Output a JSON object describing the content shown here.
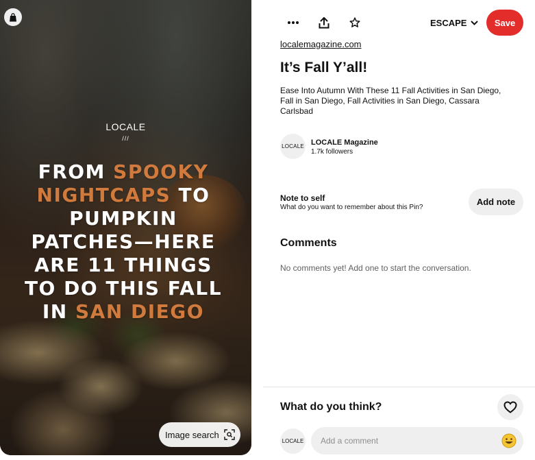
{
  "image_panel": {
    "brand": "LOCALE",
    "brand_mark": "///",
    "headline_lines": [
      [
        {
          "t": "FROM ",
          "accent": false
        },
        {
          "t": "SPOOKY",
          "accent": true
        }
      ],
      [
        {
          "t": "NIGHTCAPS",
          "accent": true
        },
        {
          "t": " TO",
          "accent": false
        }
      ],
      [
        {
          "t": "PUMPKIN",
          "accent": false
        }
      ],
      [
        {
          "t": "PATCHES—HERE",
          "accent": false
        }
      ],
      [
        {
          "t": "ARE 11 THINGS",
          "accent": false
        }
      ],
      [
        {
          "t": "TO DO THIS FALL",
          "accent": false
        }
      ],
      [
        {
          "t": "IN ",
          "accent": false
        },
        {
          "t": "SAN DIEGO",
          "accent": true
        }
      ]
    ],
    "image_search_label": "Image search",
    "accent_color": "#d07a3e"
  },
  "toolbar": {
    "board_name": "ESCAPE",
    "save_label": "Save",
    "save_color": "#e22d2a"
  },
  "pin": {
    "source": "localemagazine.com",
    "title": "It’s Fall Y’all!",
    "description": "Ease Into Autumn With These 11 Fall Activities in San Diego, Fall in San Diego, Fall Activities in San Diego, Cassara Carlsbad"
  },
  "creator": {
    "avatar_text": "LOCALE",
    "name": "LOCALE Magazine",
    "followers": "1.7k followers"
  },
  "note": {
    "title": "Note to self",
    "subtitle": "What do you want to remember about this Pin?",
    "button_label": "Add note"
  },
  "comments": {
    "heading": "Comments",
    "empty_text": "No comments yet! Add one to start the conversation."
  },
  "footer": {
    "prompt": "What do you think?",
    "user_avatar_text": "LOCALE",
    "comment_placeholder": "Add a comment"
  }
}
